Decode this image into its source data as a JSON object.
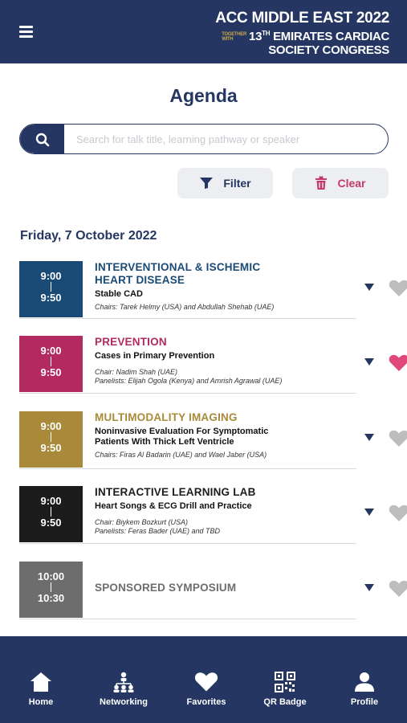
{
  "header": {
    "brand_line1": "ACC MIDDLE EAST 2022",
    "brand_together": "TOGETHER",
    "brand_with": "WITH",
    "brand_line2_num": "13",
    "brand_line2_sup": "TH",
    "brand_line2_text": "EMIRATES CARDIAC",
    "brand_line3": "SOCIETY CONGRESS"
  },
  "page_title": "Agenda",
  "search": {
    "placeholder": "Search for talk title, learning pathway or speaker",
    "value": ""
  },
  "actions": {
    "filter_label": "Filter",
    "clear_label": "Clear"
  },
  "date_heading": "Friday, 7 October 2022",
  "sessions": [
    {
      "start": "9:00",
      "end": "9:50",
      "track": "INTERVENTIONAL & ISCHEMIC HEART DISEASE",
      "title": "Stable CAD",
      "chairs": "Chairs: Tarek Helmy (USA) and Abdullah Shehab (UAE)",
      "panelists": "",
      "color": "#1a4a76",
      "track_color": "#1a4a76",
      "favorite": false
    },
    {
      "start": "9:00",
      "end": "9:50",
      "track": "PREVENTION",
      "title": "Cases in Primary Prevention",
      "chairs": "Chair: Nadim Shah (UAE)",
      "panelists": "Panelists: Elijah Ogola (Kenya) and Amrish Agrawal (UAE)",
      "color": "#b32a60",
      "track_color": "#b32a60",
      "favorite": true
    },
    {
      "start": "9:00",
      "end": "9:50",
      "track": "MULTIMODALITY IMAGING",
      "title": "Noninvasive Evaluation For Symptomatic Patients With Thick Left Ventricle",
      "chairs": "Chairs: Firas Al Badarin (UAE) and Wael Jaber (USA)",
      "panelists": "",
      "color": "#a88a3a",
      "track_color": "#a88a3a",
      "favorite": false
    },
    {
      "start": "9:00",
      "end": "9:50",
      "track": "INTERACTIVE LEARNING LAB",
      "title": "Heart Songs & ECG Drill and Practice",
      "chairs": "Chair: Biykem Bozkurt (USA)",
      "panelists": "Panelists: Feras Bader (UAE) and TBD",
      "color": "#1c1c1c",
      "track_color": "#1c1c1c",
      "favorite": false
    },
    {
      "start": "10:00",
      "end": "10:30",
      "track": "SPONSORED SYMPOSIUM",
      "title": "",
      "chairs": "",
      "panelists": "",
      "color": "#6d6d6d",
      "track_color": "#6d6d6d",
      "favorite": false
    }
  ],
  "nav": [
    {
      "label": "Home",
      "icon": "home-icon"
    },
    {
      "label": "Networking",
      "icon": "networking-icon"
    },
    {
      "label": "Favorites",
      "icon": "heart-icon"
    },
    {
      "label": "QR Badge",
      "icon": "qr-code-icon"
    },
    {
      "label": "Profile",
      "icon": "profile-icon"
    }
  ],
  "colors": {
    "primary": "#243661",
    "favorite_active": "#e0477d",
    "favorite_inactive": "#bdbdbd",
    "clear": "#c53a67"
  }
}
